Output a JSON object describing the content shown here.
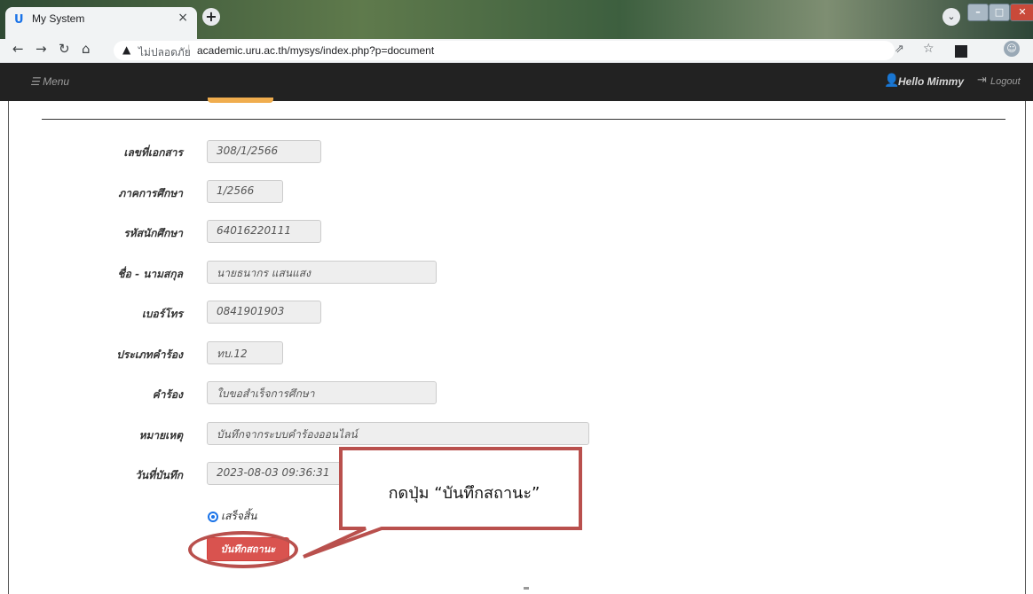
{
  "browser": {
    "tab_title": "My System",
    "tab_close": "×",
    "new_tab": "+",
    "tab_search": "⌄",
    "security_label": "ไม่ปลอดภัย",
    "url": "academic.uru.ac.th/mysys/index.php?p=document"
  },
  "navbar": {
    "menu_label": "☰ Menu",
    "user_greeting": "Hello Mimmy",
    "logout_label": "Logout"
  },
  "form": {
    "fields": [
      {
        "label": "เลขที่เอกสาร",
        "value": "308/1/2566"
      },
      {
        "label": "ภาคการศึกษา",
        "value": "1/2566"
      },
      {
        "label": "รหัสนักศึกษา",
        "value": "64016220111"
      },
      {
        "label": "ชื่อ - นามสกุล",
        "value": "นายธนากร แสนแสง"
      },
      {
        "label": "เบอร์โทร",
        "value": "0841901903"
      },
      {
        "label": "ประเภทคำร้อง",
        "value": "ทบ.12"
      },
      {
        "label": "คำร้อง",
        "value": "ใบขอสำเร็จการศึกษา"
      },
      {
        "label": "หมายเหตุ",
        "value": "บันทึกจากระบบคำร้องออนไลน์"
      },
      {
        "label": "วันที่บันทึก",
        "value": "2023-08-03 09:36:31"
      }
    ],
    "status_option": "เสร็จสิ้น",
    "save_button": "บันทึกสถานะ"
  },
  "annotation": {
    "callout_text": "กดปุ่ม “บันทึกสถานะ”",
    "color": "#b9504d"
  },
  "colors": {
    "navbar_bg": "#222222",
    "save_button_bg": "#d9534f",
    "input_bg": "#eeeeee"
  }
}
